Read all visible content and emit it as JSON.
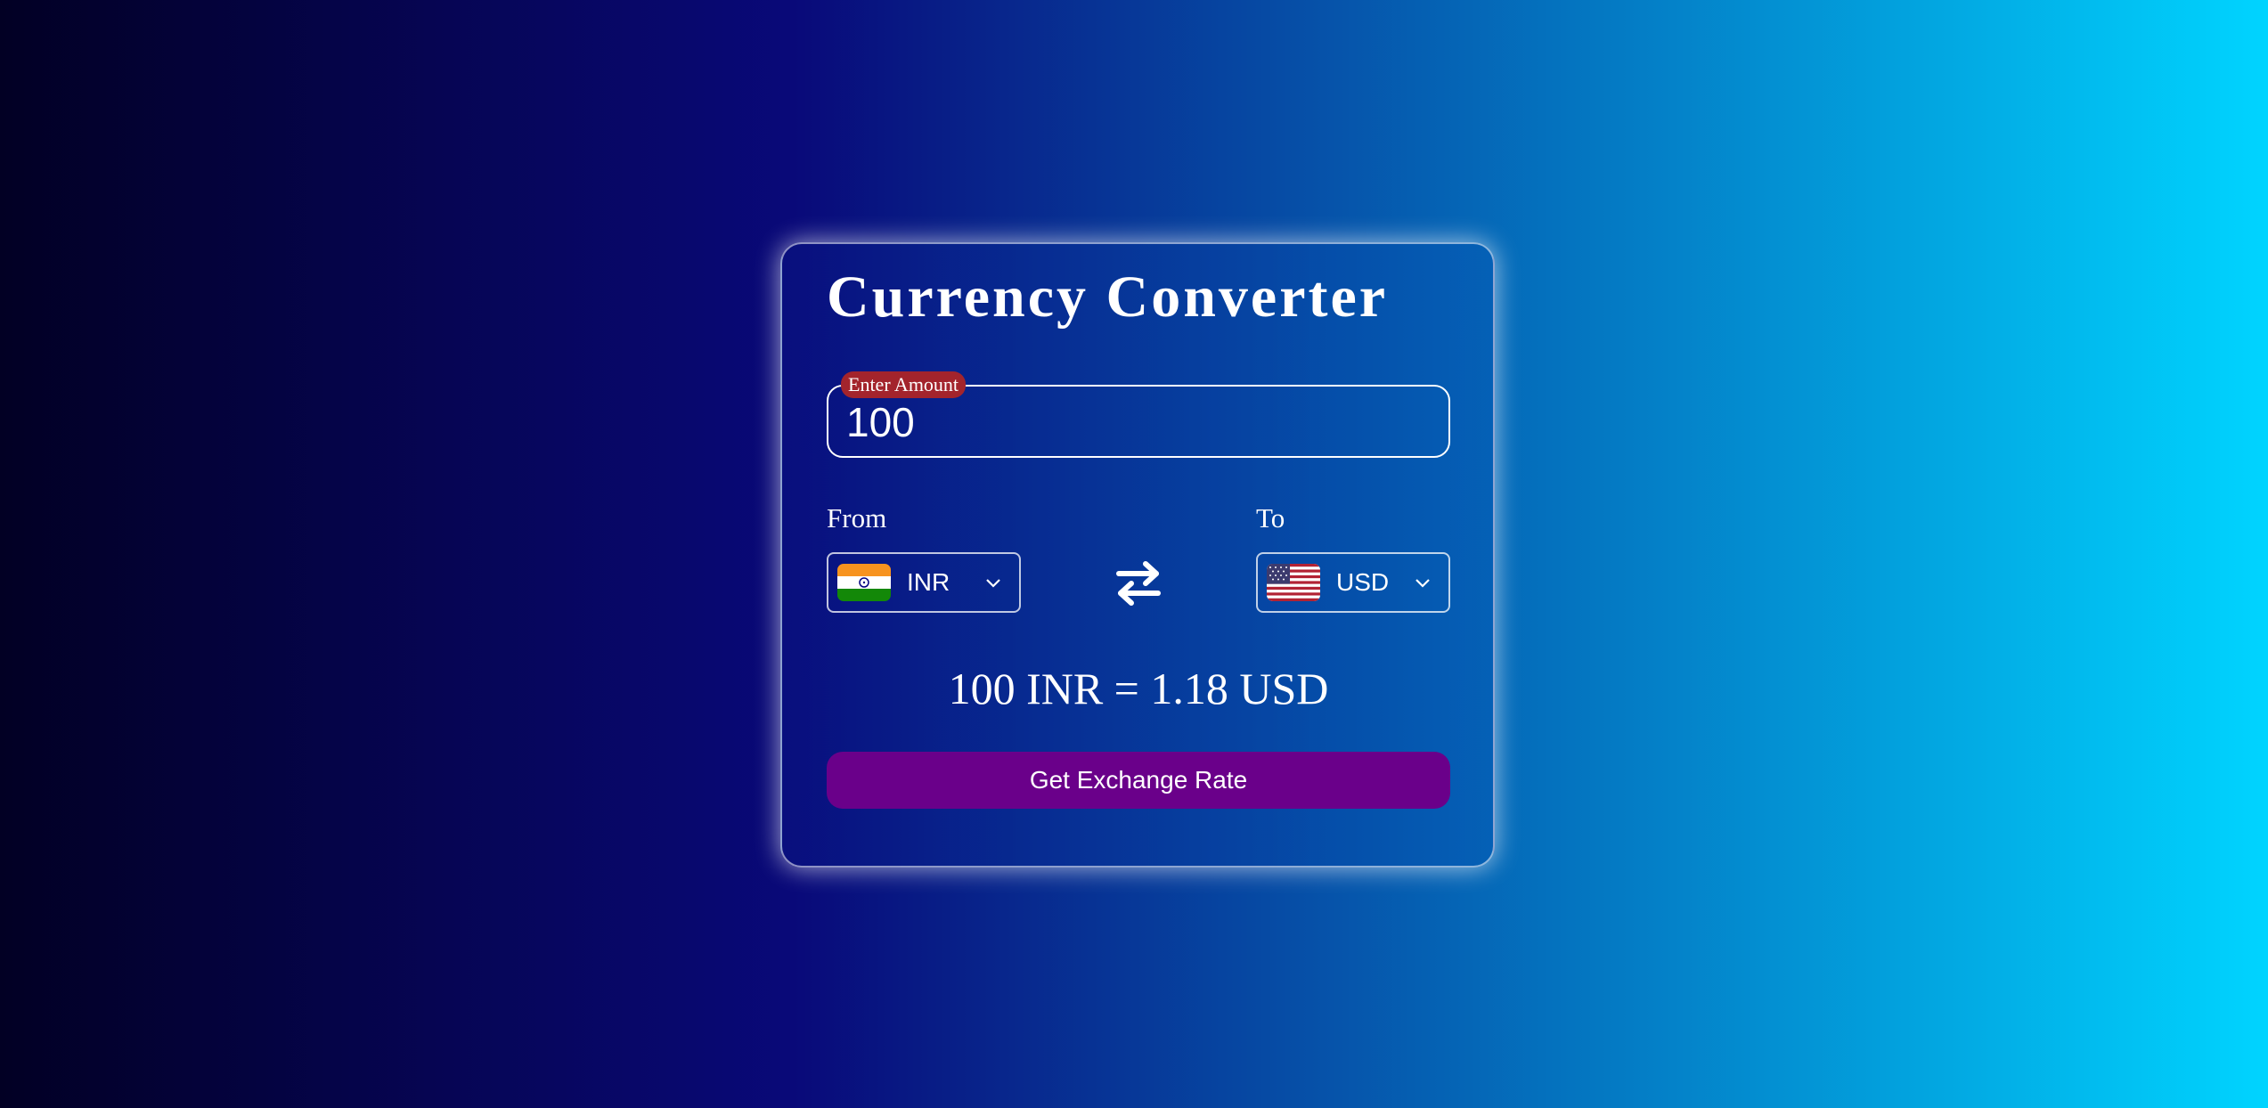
{
  "app": {
    "title": "Currency Converter"
  },
  "amount": {
    "label": "Enter Amount",
    "value": "100"
  },
  "from": {
    "label": "From",
    "currency": "INR",
    "flag_icon": "india-flag-icon"
  },
  "to": {
    "label": "To",
    "currency": "USD",
    "flag_icon": "usa-flag-icon"
  },
  "swap": {
    "icon": "swap-arrows-icon"
  },
  "result": {
    "text": "100 INR = 1.18 USD"
  },
  "action": {
    "button_label": "Get Exchange Rate"
  },
  "colors": {
    "background_start": "#020024",
    "background_mid": "#090979",
    "background_end": "#00d4ff",
    "label_badge": "#a3242c",
    "button": "#6a008a"
  }
}
